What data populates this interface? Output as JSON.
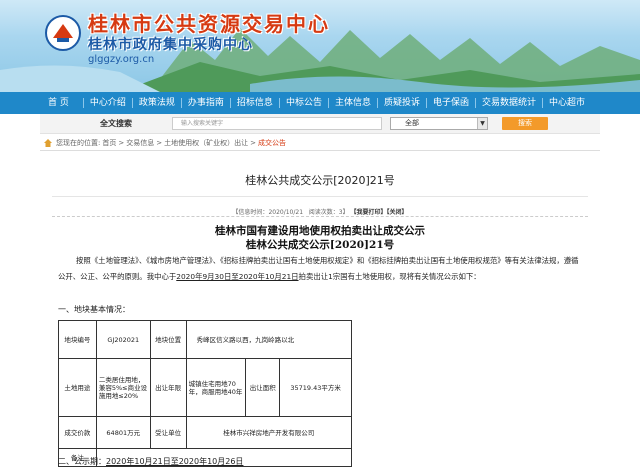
{
  "banner": {
    "title": "桂林市公共资源交易中心",
    "subtitle": "桂林市政府集中采购中心",
    "domain": "glggzy.org.cn"
  },
  "nav": {
    "items": [
      "首  页",
      "中心介绍",
      "政策法规",
      "办事指南",
      "招标信息",
      "中标公告",
      "主体信息",
      "质疑投诉",
      "电子保函",
      "交易数据统计",
      "中心超市"
    ]
  },
  "search": {
    "label": "全文搜索",
    "placeholder": "输入搜索关键字",
    "select_value": "全部",
    "button_label": "搜索"
  },
  "breadcrumb": {
    "prefix": "您现在的位置:",
    "items": [
      "首页",
      "交易信息",
      "土地使用权（矿业权）出让"
    ],
    "current": "成交公告"
  },
  "page_title": "桂林公共成交公示[2020]21号",
  "meta": {
    "date_label": "【信息时间：",
    "date": "2020/10/21",
    "views_label": "阅读次数：",
    "views": "3",
    "print": "【我要打印】",
    "close": "【关闭】"
  },
  "heading1": "桂林市国有建设用地使用权拍卖出让成交公示",
  "heading2": "桂林公共成交公示[2020]21号",
  "para": {
    "part1": "按照《土地管理法》、《城市房地产管理法》、《招标挂牌拍卖出让国有土地使用权规定》和《招标挂牌拍卖出让国有土地使用权规范》等有关法律法规，遵循公开、公正、公平的原则。我中心于",
    "date_range": "2020年9月30日至2020年10月21日",
    "part2": "拍卖出让1宗国有土地使用权，现将有关情况公示如下："
  },
  "section1": "一、地块基本情况：",
  "table": {
    "r1": {
      "k1": "地块编号",
      "v1": "GJ202021",
      "k2": "地块位置",
      "v2": "秀峰区信义路以西，九岗岭路以北"
    },
    "r2": {
      "k1": "土地用途",
      "v1": "二类居住用地，兼容5%≤商业设施用地≤20%",
      "k2": "出让年限",
      "v2": "城镇住宅用地70年，商服用地40年",
      "k3": "出让面积",
      "v3": "35719.43平方米"
    },
    "r3": {
      "k1": "成交价款",
      "v1": "64801万元",
      "k2": "受让单位",
      "v2": "桂林市兴祥房地产开发有限公司"
    },
    "r4": {
      "k1": "备注",
      "v1": ""
    }
  },
  "section2": {
    "label": "二、公示期：",
    "range": "2020年10月21日至2020年10月26日"
  },
  "colors": {
    "nav": "#1f88c9",
    "accent": "#d63a12",
    "button": "#f39a2a"
  }
}
